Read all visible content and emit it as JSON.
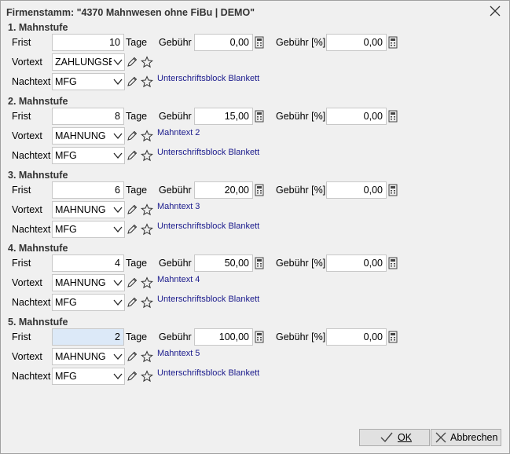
{
  "window": {
    "title": "Firmenstamm: \"4370 Mahnwesen ohne FiBu | DEMO\""
  },
  "labels": {
    "frist": "Frist",
    "tage": "Tage",
    "gebuehr": "Gebühr",
    "gebuehr_pct": "Gebühr [%]",
    "vortext": "Vortext",
    "nachtext": "Nachtext"
  },
  "stufen": [
    {
      "title": "1. Mahnstufe",
      "frist": "10",
      "gebuehr": "0,00",
      "gebuehr_pct": "0,00",
      "vortext": "ZAHLUNGSE",
      "vortext_link": "",
      "nachtext": "MFG",
      "nachtext_link": "Unterschriftsblock Blankett"
    },
    {
      "title": "2. Mahnstufe",
      "frist": "8",
      "gebuehr": "15,00",
      "gebuehr_pct": "0,00",
      "vortext": "MAHNUNG",
      "vortext_link": "Mahntext 2",
      "nachtext": "MFG",
      "nachtext_link": "Unterschriftsblock Blankett"
    },
    {
      "title": "3. Mahnstufe",
      "frist": "6",
      "gebuehr": "20,00",
      "gebuehr_pct": "0,00",
      "vortext": "MAHNUNG",
      "vortext_link": "Mahntext 3",
      "nachtext": "MFG",
      "nachtext_link": "Unterschriftsblock Blankett"
    },
    {
      "title": "4. Mahnstufe",
      "frist": "4",
      "gebuehr": "50,00",
      "gebuehr_pct": "0,00",
      "vortext": "MAHNUNG",
      "vortext_link": "Mahntext 4",
      "nachtext": "MFG",
      "nachtext_link": "Unterschriftsblock Blankett"
    },
    {
      "title": "5. Mahnstufe",
      "frist": "2",
      "gebuehr": "100,00",
      "gebuehr_pct": "0,00",
      "vortext": "MAHNUNG",
      "vortext_link": "Mahntext 5",
      "nachtext": "MFG",
      "nachtext_link": "Unterschriftsblock Blankett"
    }
  ],
  "buttons": {
    "ok": "OK",
    "cancel": "Abbrechen"
  },
  "colors": {
    "focus_bg": "#dce9f8",
    "link": "#1a1a8c"
  }
}
